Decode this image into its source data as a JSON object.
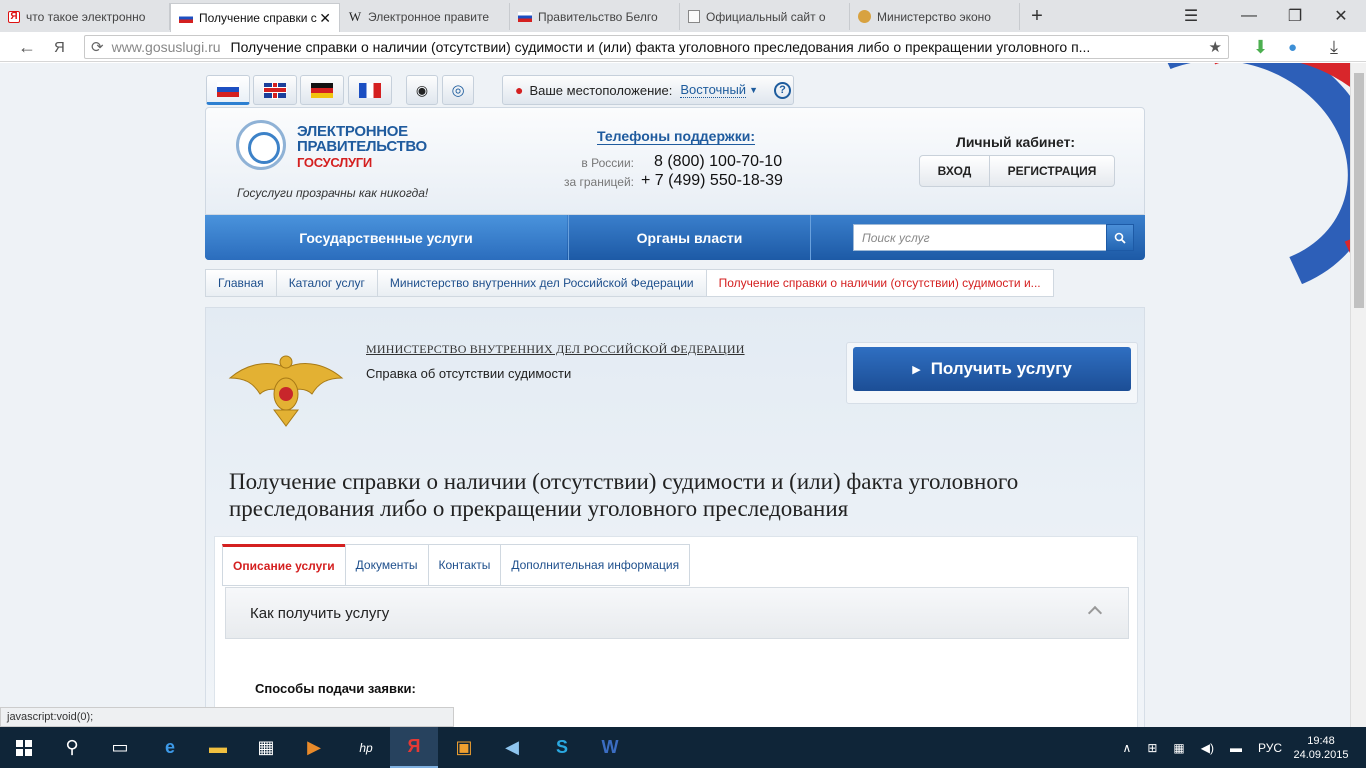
{
  "browser": {
    "tabs": [
      {
        "label": "что такое электронно",
        "favicon": "yandex-icon"
      },
      {
        "label": "Получение справки с",
        "favicon": "russia-flag-icon",
        "active": true
      },
      {
        "label": "Электронное правите",
        "favicon": "wikipedia-icon"
      },
      {
        "label": "Правительство Белго",
        "favicon": "russia-flag-icon"
      },
      {
        "label": "Официальный сайт о",
        "favicon": "document-icon"
      },
      {
        "label": "Министерство эконо",
        "favicon": "emblem-icon"
      }
    ],
    "address": {
      "host": "www.gosuslugi.ru",
      "title": "Получение справки о наличии (отсутствии) судимости и (или) факта уголовного преследования либо о прекращении уголовного п..."
    },
    "yandex_letter": "Я",
    "status_text": "javascript:void(0);"
  },
  "site": {
    "location": {
      "label": "Ваше местоположение:",
      "city": "Восточный",
      "help": "?"
    },
    "logo": {
      "line1": "ЭЛЕКТРОННОЕ",
      "line2": "ПРАВИТЕЛЬСТВО",
      "line3": "ГОСУСЛУГИ",
      "slogan": "Госуслуги прозрачны как никогда!"
    },
    "support": {
      "title": "Телефоны поддержки",
      "colon": ":",
      "russia_label": "в России:",
      "russia_phone": "8 (800) 100-70-10",
      "abroad_label": "за границей:",
      "abroad_phone": "+ 7 (499) 550-18-39"
    },
    "cabinet": {
      "title": "Личный кабинет:",
      "login": "ВХОД",
      "register": "РЕГИСТРАЦИЯ"
    },
    "nav": {
      "services": "Государственные услуги",
      "authorities": "Органы власти",
      "search_placeholder": "Поиск услуг"
    },
    "breadcrumbs": [
      "Главная",
      "Каталог услуг",
      "Министерство внутренних дел Российской Федерации",
      "Получение справки о наличии (отсутствии) судимости и..."
    ],
    "ministry": "МИНИСТЕРСТВО ВНУТРЕННИХ ДЕЛ РОССИЙСКОЙ ФЕДЕРАЦИИ",
    "service_short": "Справка об отсутствии судимости",
    "get_service": "Получить услугу",
    "service_title": "Получение справки о наличии (отсутствии) судимости и (или) факта уголовного преследования либо о прекращении уголовного преследования",
    "tabs": [
      "Описание услуги",
      "Документы",
      "Контакты",
      "Дополнительная информация"
    ],
    "accordion": "Как получить услугу",
    "ways": "Способы подачи заявки:"
  },
  "taskbar": {
    "lang": "РУС",
    "time": "19:48",
    "date": "24.09.2015",
    "hp": "hp",
    "word": "W",
    "skype": "S"
  }
}
